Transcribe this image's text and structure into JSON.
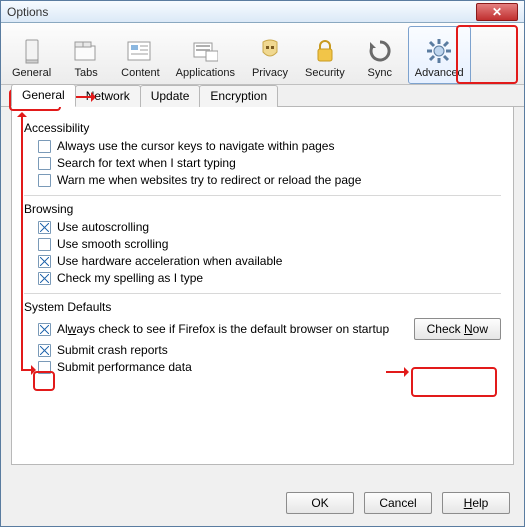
{
  "window": {
    "title": "Options"
  },
  "toolbar": [
    {
      "id": "general",
      "label": "General"
    },
    {
      "id": "tabs",
      "label": "Tabs"
    },
    {
      "id": "content",
      "label": "Content"
    },
    {
      "id": "applications",
      "label": "Applications"
    },
    {
      "id": "privacy",
      "label": "Privacy"
    },
    {
      "id": "security",
      "label": "Security"
    },
    {
      "id": "sync",
      "label": "Sync"
    },
    {
      "id": "advanced",
      "label": "Advanced",
      "selected": true
    }
  ],
  "subtabs": [
    {
      "id": "general",
      "label": "General",
      "active": true
    },
    {
      "id": "network",
      "label": "Network"
    },
    {
      "id": "update",
      "label": "Update"
    },
    {
      "id": "encryption",
      "label": "Encryption"
    }
  ],
  "groups": {
    "accessibility": {
      "title": "Accessibility",
      "items": [
        {
          "label": "Always use the cursor keys to navigate within pages",
          "checked": false
        },
        {
          "label": "Search for text when I start typing",
          "checked": false
        },
        {
          "label": "Warn me when websites try to redirect or reload the page",
          "checked": false
        }
      ]
    },
    "browsing": {
      "title": "Browsing",
      "items": [
        {
          "label": "Use autoscrolling",
          "checked": true
        },
        {
          "label": "Use smooth scrolling",
          "checked": false
        },
        {
          "label": "Use hardware acceleration when available",
          "checked": true
        },
        {
          "label": "Check my spelling as I type",
          "checked": true
        }
      ]
    },
    "system_defaults": {
      "title": "System Defaults",
      "default_check": {
        "label": "Always check to see if Firefox is the default browser on startup",
        "checked": true
      },
      "check_now_label": "Check Now",
      "crash": {
        "label": "Submit crash reports",
        "checked": true
      },
      "perf": {
        "label": "Submit performance data",
        "checked": false
      }
    }
  },
  "footer": {
    "ok": "OK",
    "cancel": "Cancel",
    "help": "Help"
  }
}
